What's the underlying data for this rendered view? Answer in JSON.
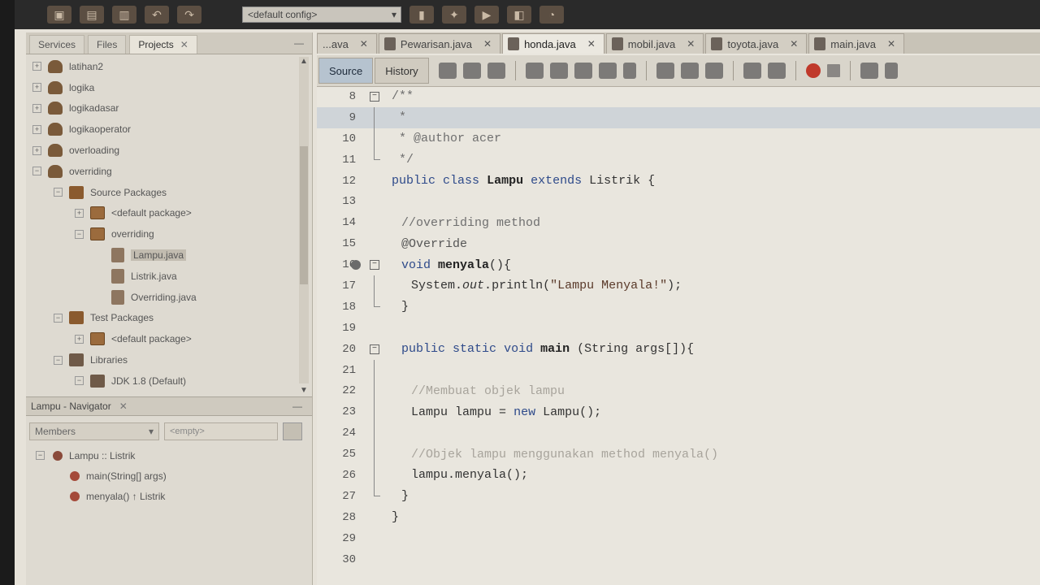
{
  "toolbar": {
    "config_combo": "<default config>"
  },
  "left_panel": {
    "tabs": [
      {
        "label": "Services"
      },
      {
        "label": "Files"
      },
      {
        "label": "Projects",
        "active": true
      }
    ],
    "tree": [
      {
        "label": "latihan2",
        "indent": 0,
        "icon": "project-icon"
      },
      {
        "label": "logika",
        "indent": 0,
        "icon": "project-icon"
      },
      {
        "label": "logikadasar",
        "indent": 0,
        "icon": "project-icon"
      },
      {
        "label": "logikaoperator",
        "indent": 0,
        "icon": "project-icon"
      },
      {
        "label": "overloading",
        "indent": 0,
        "icon": "project-icon"
      },
      {
        "label": "overriding",
        "indent": 0,
        "icon": "project-icon"
      },
      {
        "label": "Source Packages",
        "indent": 1,
        "icon": "folder-icon"
      },
      {
        "label": "<default package>",
        "indent": 2,
        "icon": "package-icon"
      },
      {
        "label": "overriding",
        "indent": 2,
        "icon": "package-icon"
      },
      {
        "label": "Lampu.java",
        "indent": 3,
        "icon": "java-file-icon",
        "selected": true
      },
      {
        "label": "Listrik.java",
        "indent": 3,
        "icon": "java-file-icon"
      },
      {
        "label": "Overriding.java",
        "indent": 3,
        "icon": "java-file-icon"
      },
      {
        "label": "Test Packages",
        "indent": 1,
        "icon": "folder-icon"
      },
      {
        "label": "<default package>",
        "indent": 2,
        "icon": "package-icon"
      },
      {
        "label": "Libraries",
        "indent": 1,
        "icon": "library-icon"
      },
      {
        "label": "JDK 1.8 (Default)",
        "indent": 2,
        "icon": "library-icon"
      }
    ],
    "navigator": {
      "title": "Lampu - Navigator",
      "filter": "Members",
      "empty": "<empty>",
      "items": [
        {
          "label": "Lampu :: Listrik",
          "indent": 0
        },
        {
          "label": "main(String[] args)",
          "indent": 1
        },
        {
          "label": "menyala() ↑ Listrik",
          "indent": 1
        }
      ]
    }
  },
  "editor": {
    "tabs": [
      {
        "label": "...ava"
      },
      {
        "label": "Pewarisan.java"
      },
      {
        "label": "honda.java",
        "active": true
      },
      {
        "label": "mobil.java"
      },
      {
        "label": "toyota.java"
      },
      {
        "label": "main.java"
      }
    ],
    "source_label": "Source",
    "history_label": "History",
    "lines": [
      {
        "n": "8",
        "text": "/**",
        "cls": "cm",
        "indent": 0
      },
      {
        "n": "9",
        "text": " *",
        "cls": "cm",
        "indent": 0,
        "hl": true
      },
      {
        "n": "10",
        "text": " * @author acer",
        "cls": "cm",
        "indent": 0
      },
      {
        "n": "11",
        "text": " */",
        "cls": "cm",
        "indent": 0
      },
      {
        "n": "12",
        "text": "public class Lampu extends Listrik {",
        "indent": 0
      },
      {
        "n": "13",
        "text": "",
        "indent": 0
      },
      {
        "n": "14",
        "text": "//overriding method",
        "cls": "cm",
        "indent": 1
      },
      {
        "n": "15",
        "text": "@Override",
        "cls": "an",
        "indent": 1
      },
      {
        "n": "16",
        "text": "void menyala(){",
        "indent": 1
      },
      {
        "n": "17",
        "text": "System.out.println(\"Lampu Menyala!\");",
        "indent": 2
      },
      {
        "n": "18",
        "text": "}",
        "indent": 1
      },
      {
        "n": "19",
        "text": "",
        "indent": 0
      },
      {
        "n": "20",
        "text": "public static void main (String args[]){",
        "indent": 1
      },
      {
        "n": "21",
        "text": "",
        "indent": 0
      },
      {
        "n": "22",
        "text": "//Membuat objek lampu",
        "cls": "cm faint",
        "indent": 2
      },
      {
        "n": "23",
        "text": "Lampu lampu = new Lampu();",
        "indent": 2
      },
      {
        "n": "24",
        "text": "",
        "indent": 0
      },
      {
        "n": "25",
        "text": "//Objek lampu menggunakan method menyala()",
        "cls": "cm faint",
        "indent": 2
      },
      {
        "n": "26",
        "text": "lampu.menyala();",
        "indent": 2
      },
      {
        "n": "27",
        "text": "}",
        "indent": 1
      },
      {
        "n": "28",
        "text": "}",
        "indent": 0
      },
      {
        "n": "29",
        "text": "",
        "indent": 0
      },
      {
        "n": "30",
        "text": "",
        "indent": 0
      }
    ]
  }
}
